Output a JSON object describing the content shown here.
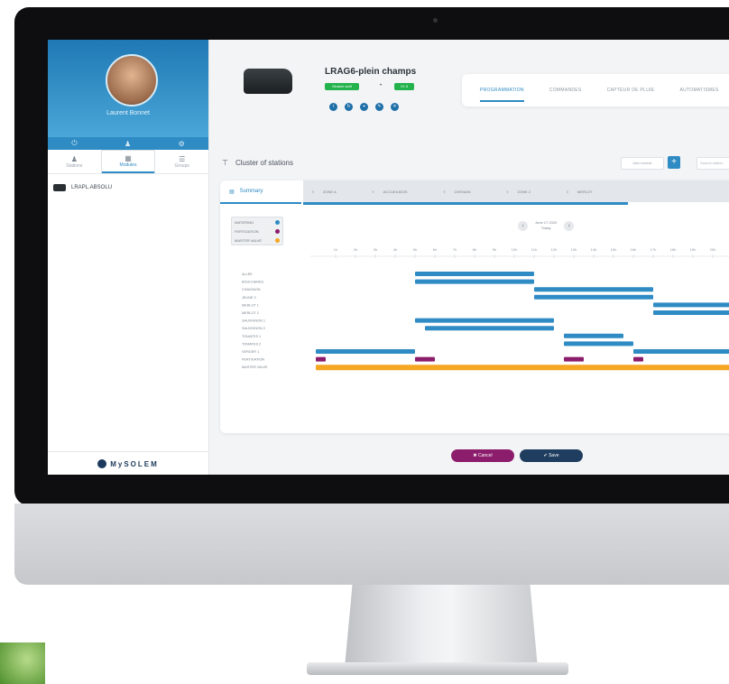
{
  "sidebar": {
    "user_name": "Laurent Bonnet",
    "tabs": [
      {
        "label": "Stations",
        "icon": "person-icon"
      },
      {
        "label": "Modules",
        "icon": "grid-icon"
      },
      {
        "label": "Groups",
        "icon": "list-icon"
      }
    ],
    "device": "LRAPL.ABSOLU",
    "logo": "MySOLEM"
  },
  "device_header": {
    "title": "LRAG6-plein champs",
    "status": "Module actif",
    "separator": "•",
    "version": "V1.5"
  },
  "top_nav": [
    "PROGRAMMATION",
    "COMMANDES",
    "CAPTEUR DE PLUIE",
    "AUTOMATISMES"
  ],
  "cluster": {
    "title": "Cluster of stations",
    "add_module": "Add module",
    "search_placeholder": "Search station"
  },
  "schedule": {
    "summary_tab": "Summary",
    "zones": [
      "ZONE A",
      "ACCUEILBOIS",
      "CHENAIN",
      "ZONE 2",
      "MERLOT"
    ],
    "date": "June 17 2020",
    "date_sub": "Today",
    "legend": [
      {
        "label": "WATERING",
        "color": "#2f8bc4"
      },
      {
        "label": "FERTIGATION",
        "color": "#8c1d6c"
      },
      {
        "label": "MASTER VALVE",
        "color": "#f5a623"
      }
    ]
  },
  "chart_data": {
    "type": "gantt",
    "hours": [
      "1h",
      "2h",
      "3h",
      "4h",
      "5h",
      "6h",
      "7h",
      "8h",
      "9h",
      "10h",
      "11h",
      "12h",
      "13h",
      "14h",
      "15h",
      "16h",
      "17h",
      "18h",
      "19h",
      "20h",
      "21h",
      "22h"
    ],
    "rows": [
      "ALLEE",
      "BOUCHERES",
      "CHAIGNON",
      "JEUNE 3",
      "MERLOT 1",
      "MERLOT 2",
      "SAUVIGNON 1",
      "SAUVIGNON 2",
      "TOMATES 1",
      "TOMATES 2",
      "VERGER 1",
      "FERTIGATION",
      "MASTER VALVE"
    ],
    "bars": [
      {
        "row": 0,
        "start": 5,
        "end": 11,
        "kind": "watering"
      },
      {
        "row": 1,
        "start": 5,
        "end": 11,
        "kind": "watering"
      },
      {
        "row": 2,
        "start": 11,
        "end": 17,
        "kind": "watering"
      },
      {
        "row": 3,
        "start": 11,
        "end": 17,
        "kind": "watering"
      },
      {
        "row": 4,
        "start": 17,
        "end": 23,
        "kind": "watering"
      },
      {
        "row": 5,
        "start": 17,
        "end": 23,
        "kind": "watering"
      },
      {
        "row": 6,
        "start": 5,
        "end": 12,
        "kind": "watering"
      },
      {
        "row": 7,
        "start": 5.5,
        "end": 12,
        "kind": "watering"
      },
      {
        "row": 8,
        "start": 12.5,
        "end": 15.5,
        "kind": "watering"
      },
      {
        "row": 9,
        "start": 12.5,
        "end": 16,
        "kind": "watering"
      },
      {
        "row": 10,
        "start": 0,
        "end": 5,
        "kind": "watering"
      },
      {
        "row": 10,
        "start": 16,
        "end": 23,
        "kind": "watering"
      },
      {
        "row": 11,
        "start": 0,
        "end": 0.5,
        "kind": "fertigation"
      },
      {
        "row": 11,
        "start": 5,
        "end": 6,
        "kind": "fertigation"
      },
      {
        "row": 11,
        "start": 12.5,
        "end": 13.5,
        "kind": "fertigation"
      },
      {
        "row": 11,
        "start": 16,
        "end": 16.5,
        "kind": "fertigation"
      },
      {
        "row": 12,
        "start": 0,
        "end": 23,
        "kind": "master"
      }
    ],
    "colors": {
      "watering": "#2f8bc4",
      "fertigation": "#8c1d6c",
      "master": "#f5a623"
    }
  },
  "actions": {
    "cancel": "✖ Cancel",
    "save": "✔ Save"
  }
}
